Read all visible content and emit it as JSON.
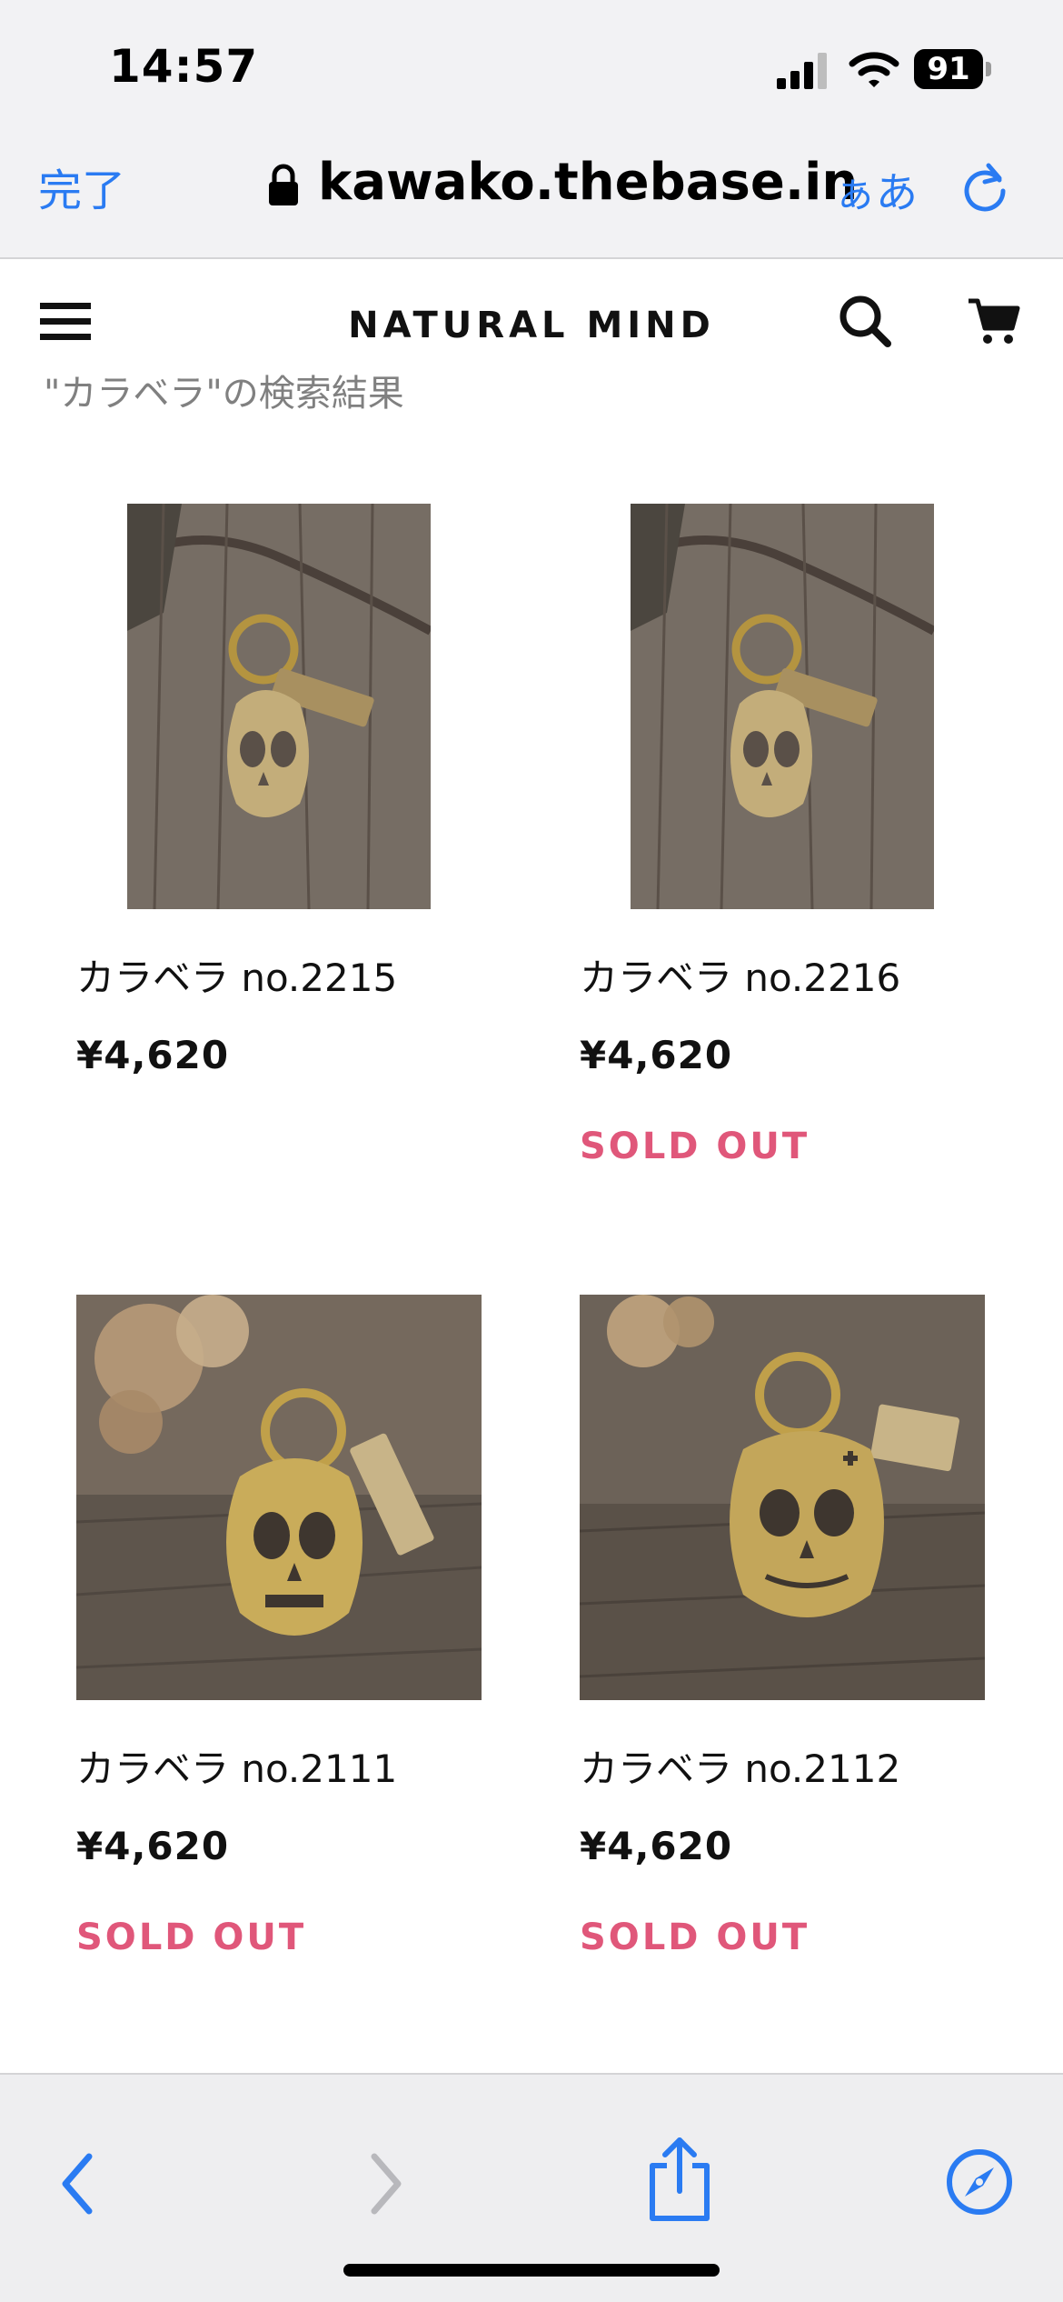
{
  "status_bar": {
    "time": "14:57",
    "battery": "91",
    "icons": [
      "signal-icon",
      "wifi-icon",
      "battery-icon"
    ]
  },
  "browser": {
    "done_label": "完了",
    "url": "kawako.thebase.in",
    "text_size_label": "ぁあ",
    "icons": [
      "lock-icon",
      "reload-icon"
    ]
  },
  "site": {
    "title": "NATURAL MIND",
    "icons": [
      "menu-icon",
      "search-icon",
      "cart-icon"
    ]
  },
  "search": {
    "heading": "\"カラベラ\"の検索結果"
  },
  "products": [
    {
      "name": "カラベラ no.2215",
      "price": "¥4,620",
      "status": ""
    },
    {
      "name": "カラベラ no.2216",
      "price": "¥4,620",
      "status": "SOLD OUT"
    },
    {
      "name": "カラベラ no.2111",
      "price": "¥4,620",
      "status": "SOLD OUT"
    },
    {
      "name": "カラベラ no.2112",
      "price": "¥4,620",
      "status": "SOLD OUT"
    }
  ],
  "toolbar": {
    "icons": [
      "back-icon",
      "forward-icon",
      "share-icon",
      "compass-icon"
    ]
  },
  "colors": {
    "accent": "#2a7bf2",
    "sold_out": "#e0577a",
    "chrome_bg": "#f2f2f4"
  }
}
